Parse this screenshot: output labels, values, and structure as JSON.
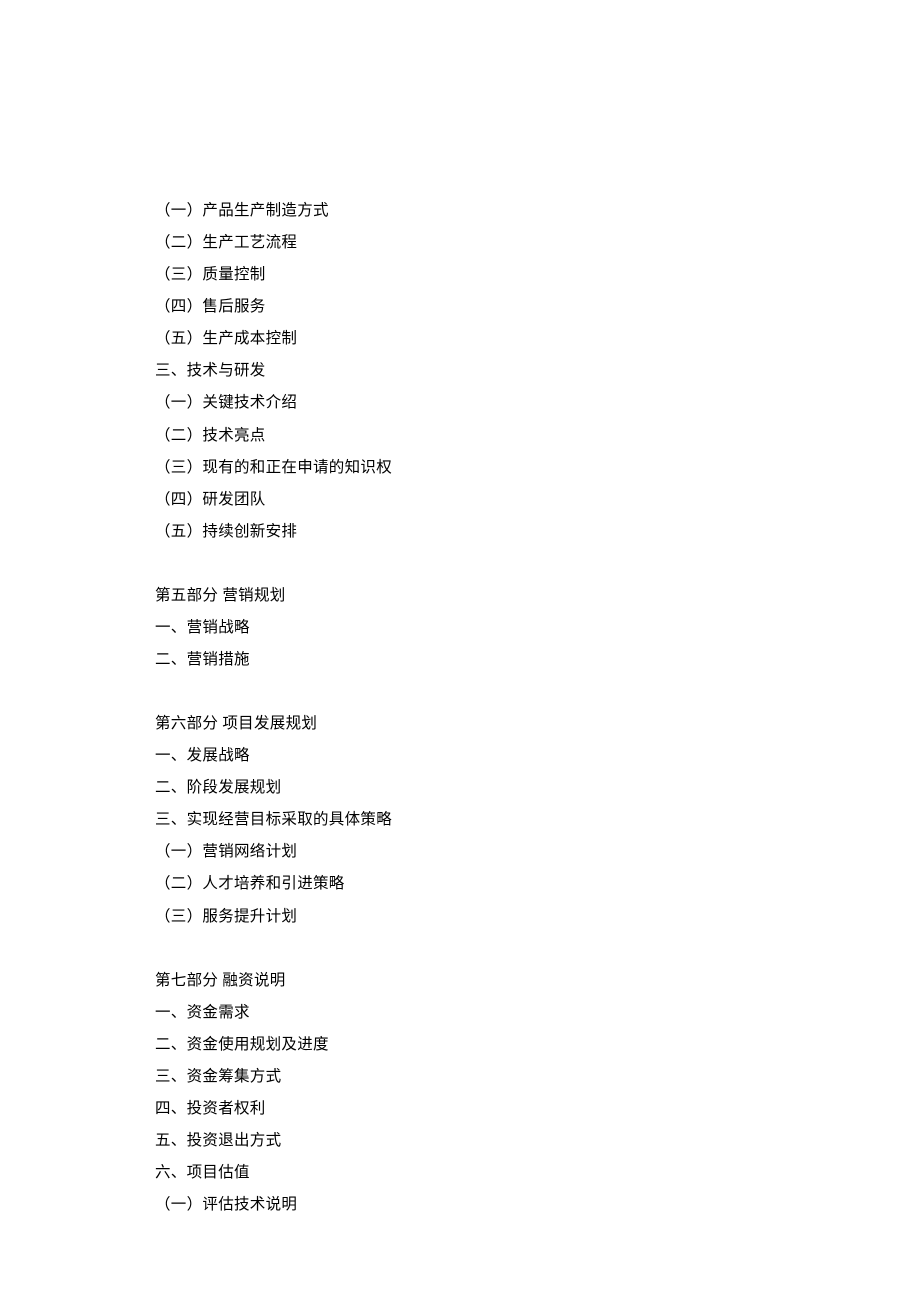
{
  "lines": [
    "（一）产品生产制造方式",
    "（二）生产工艺流程",
    "（三）质量控制",
    "（四）售后服务",
    "（五）生产成本控制",
    "三、技术与研发",
    "（一）关键技术介绍",
    "（二）技术亮点",
    "（三）现有的和正在申请的知识权",
    "（四）研发团队",
    "（五）持续创新安排",
    "",
    "第五部分  营销规划",
    "一、营销战略",
    "二、营销措施",
    "",
    "第六部分  项目发展规划",
    "一、发展战略",
    "二、阶段发展规划",
    "三、实现经营目标采取的具体策略",
    "（一）营销网络计划",
    "（二）人才培养和引进策略",
    "（三）服务提升计划",
    "",
    "第七部分 融资说明",
    "一、资金需求",
    "二、资金使用规划及进度",
    "三、资金筹集方式",
    "四、投资者权利",
    "五、投资退出方式",
    "六、项目估值",
    "（一）评估技术说明"
  ]
}
